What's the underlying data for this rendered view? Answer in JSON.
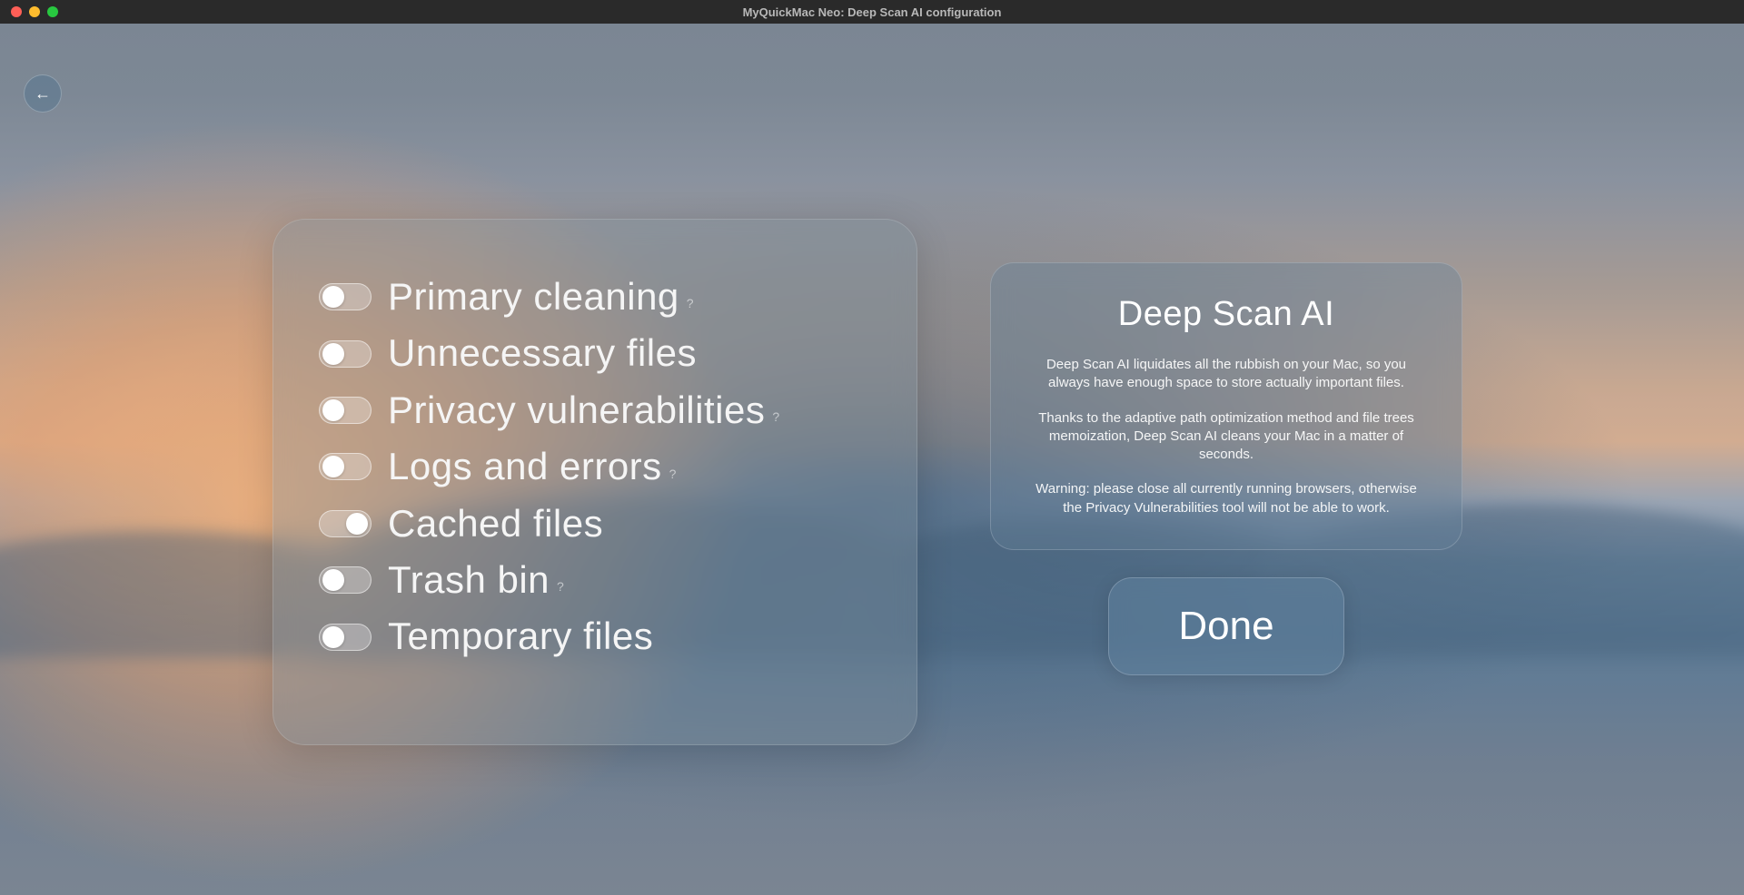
{
  "window": {
    "title": "MyQuickMac Neo: Deep Scan AI configuration"
  },
  "back_arrow": "←",
  "options": [
    {
      "label": "Primary cleaning",
      "on": false,
      "help": true
    },
    {
      "label": "Unnecessary files",
      "on": false,
      "help": false
    },
    {
      "label": "Privacy vulnerabilities",
      "on": false,
      "help": true
    },
    {
      "label": "Logs and errors",
      "on": false,
      "help": true
    },
    {
      "label": "Cached files",
      "on": true,
      "help": false
    },
    {
      "label": "Trash bin",
      "on": false,
      "help": true
    },
    {
      "label": "Temporary files",
      "on": false,
      "help": false
    }
  ],
  "help_glyph": "?",
  "info": {
    "title": "Deep Scan AI",
    "p1": "Deep Scan AI liquidates all the rubbish on your Mac, so you always have enough space to store actually important files.",
    "p2": "Thanks to the adaptive path optimization method and file trees memoization, Deep Scan AI cleans your Mac in a matter of seconds.",
    "p3": "Warning: please close all currently running browsers, otherwise the Privacy Vulnerabilities tool will not be able to work."
  },
  "done_label": "Done"
}
